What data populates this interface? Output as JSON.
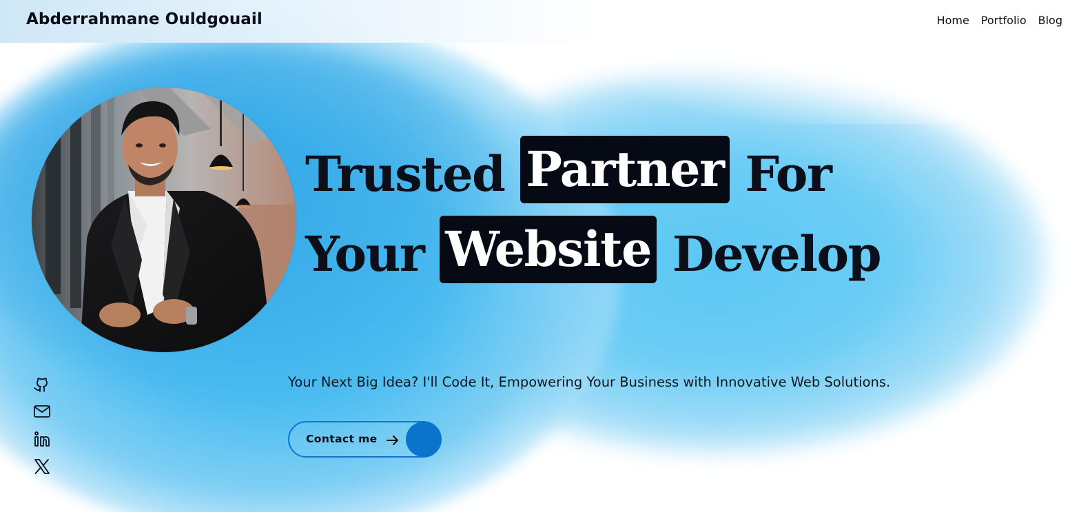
{
  "header": {
    "brand": "Abderrahmane Ouldgouail",
    "nav": [
      "Home",
      "Portfolio",
      "Blog"
    ]
  },
  "hero": {
    "headline_line1": {
      "before": "Trusted",
      "highlight": "Partner",
      "after": "For"
    },
    "headline_line2": {
      "before": "Your",
      "highlight": "Website",
      "after": "Develop"
    },
    "tagline": "Your Next Big Idea? I'll Code It, Empowering Your Business with Innovative Web Solutions.",
    "cta_label": "Contact me",
    "portrait_alt": "Portrait photo"
  },
  "social": [
    {
      "name": "github",
      "icon": "github-icon"
    },
    {
      "name": "email",
      "icon": "mail-icon"
    },
    {
      "name": "linkedin",
      "icon": "linkedin-icon"
    },
    {
      "name": "x",
      "icon": "x-icon"
    }
  ],
  "colors": {
    "accent": "#0a74cc",
    "highlight_bg": "#060a14",
    "text": "#0b0f1a",
    "glow": "#4cbdf1"
  }
}
